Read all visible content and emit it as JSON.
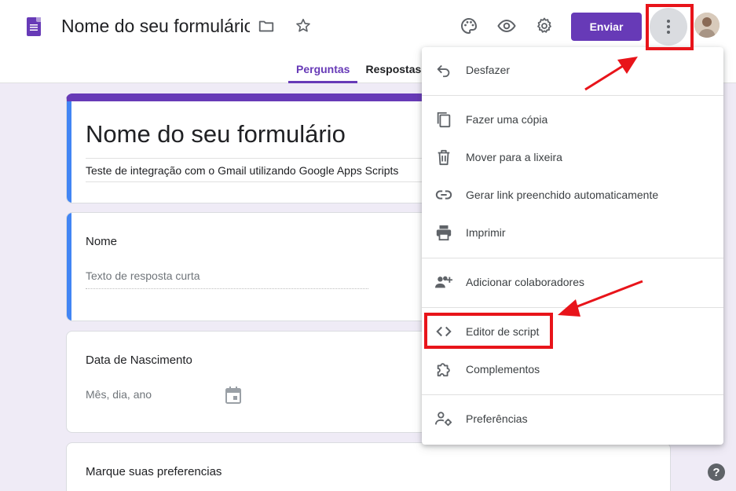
{
  "header": {
    "title": "Nome do seu formulário",
    "send_label": "Enviar",
    "tabs": [
      {
        "label": "Perguntas",
        "active": true
      },
      {
        "label": "Respostas",
        "active": false
      }
    ]
  },
  "form": {
    "title": "Nome do seu formulário",
    "description": "Teste de integração com o Gmail utilizando Google Apps Scripts",
    "questions": [
      {
        "label": "Nome",
        "placeholder": "Texto de resposta curta"
      },
      {
        "label": "Data de Nascimento",
        "placeholder": "Mês, dia, ano"
      },
      {
        "label": "Marque suas preferencias"
      }
    ]
  },
  "menu": {
    "items": [
      {
        "label": "Desfazer",
        "icon": "undo-icon"
      },
      {
        "label": "Fazer uma cópia",
        "icon": "copy-icon"
      },
      {
        "label": "Mover para a lixeira",
        "icon": "trash-icon"
      },
      {
        "label": "Gerar link preenchido automaticamente",
        "icon": "link-icon"
      },
      {
        "label": "Imprimir",
        "icon": "print-icon"
      },
      {
        "label": "Adicionar colaboradores",
        "icon": "add-people-icon"
      },
      {
        "label": "Editor de script",
        "icon": "code-icon"
      },
      {
        "label": "Complementos",
        "icon": "puzzle-icon"
      },
      {
        "label": "Preferências",
        "icon": "person-settings-icon"
      }
    ]
  },
  "colors": {
    "accent": "#673ab7",
    "annotation_red": "#e8141a",
    "background": "#efebf6",
    "active_bar": "#4285f4"
  }
}
